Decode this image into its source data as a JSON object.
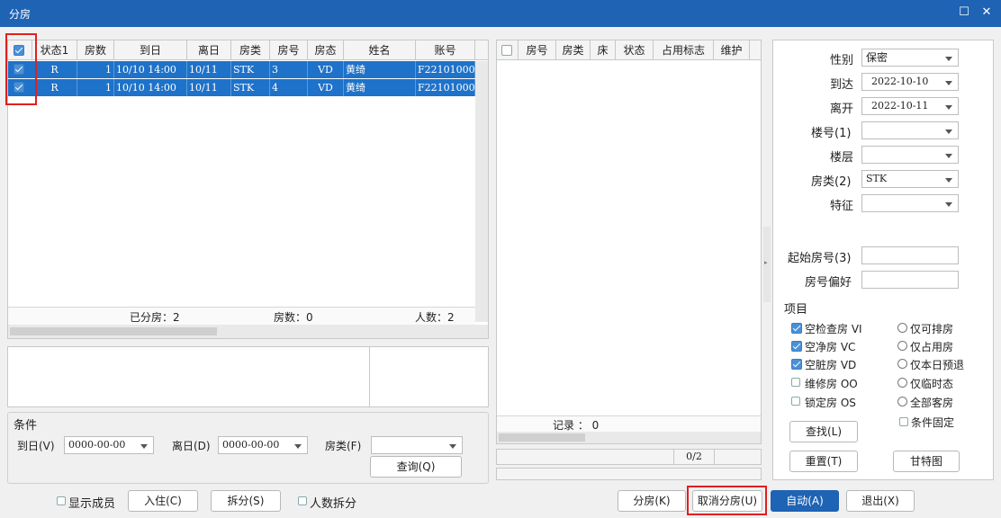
{
  "window": {
    "title": "分房",
    "max_icon": "maximize-icon",
    "close_icon": "close-icon"
  },
  "left_grid": {
    "headers": [
      "状态1",
      "房数",
      "到日",
      "离日",
      "房类",
      "房号",
      "房态",
      "姓名",
      "账号"
    ],
    "rows": [
      [
        "R",
        "1",
        "10/10 14:00",
        "10/11",
        "STK",
        "3",
        "VD",
        "黄绮",
        "F22101000"
      ],
      [
        "R",
        "1",
        "10/10 14:00",
        "10/11",
        "STK",
        "4",
        "VD",
        "黄绮",
        "F22101000"
      ]
    ],
    "summary": {
      "assigned": "已分房：2",
      "rooms": "房数：0",
      "persons": "人数：2"
    }
  },
  "right_grid": {
    "headers": [
      "房号",
      "房类",
      "床",
      "状态",
      "占用标志",
      "维护"
    ],
    "record": "记录 ： 0",
    "progress": "0/2"
  },
  "conditions": {
    "title": "条件",
    "arrive_label": "到日(V)",
    "arrive_value": "0000-00-00",
    "leave_label": "离日(D)",
    "leave_value": "0000-00-00",
    "roomtype_label": "房类(F)",
    "roomtype_value": "",
    "query_button": "查询(Q)"
  },
  "filters": {
    "gender_label": "性别",
    "gender_value": "保密",
    "arrive_label": "到达",
    "arrive_value": "2022-10-10",
    "leave_label": "离开",
    "leave_value": "2022-10-11",
    "building_label": "楼号(1)",
    "building_value": "",
    "floor_label": "楼层",
    "floor_value": "",
    "roomtype_label": "房类(2)",
    "roomtype_value": "STK",
    "feature_label": "特征",
    "feature_value": "",
    "start_room_label": "起始房号(3)",
    "room_pref_label": "房号偏好",
    "items_title": "项目",
    "checks": [
      "空检查房 VI",
      "空净房 VC",
      "空脏房 VD",
      "维修房 OO",
      "锁定房 OS"
    ],
    "radios": [
      "仅可排房",
      "仅占用房",
      "仅本日预退",
      "仅临时态",
      "全部客房"
    ],
    "fixed_label": "条件固定",
    "find_button": "查找(L)",
    "reset_button": "重置(T)",
    "gantt_button": "甘特图"
  },
  "bottom": {
    "show_members": "显示成员",
    "checkin_button": "入住(C)",
    "split_button": "拆分(S)",
    "split_persons": "人数拆分",
    "assign_button": "分房(K)",
    "cancel_assign_button": "取消分房(U)",
    "auto_button": "自动(A)",
    "exit_button": "退出(X)"
  }
}
